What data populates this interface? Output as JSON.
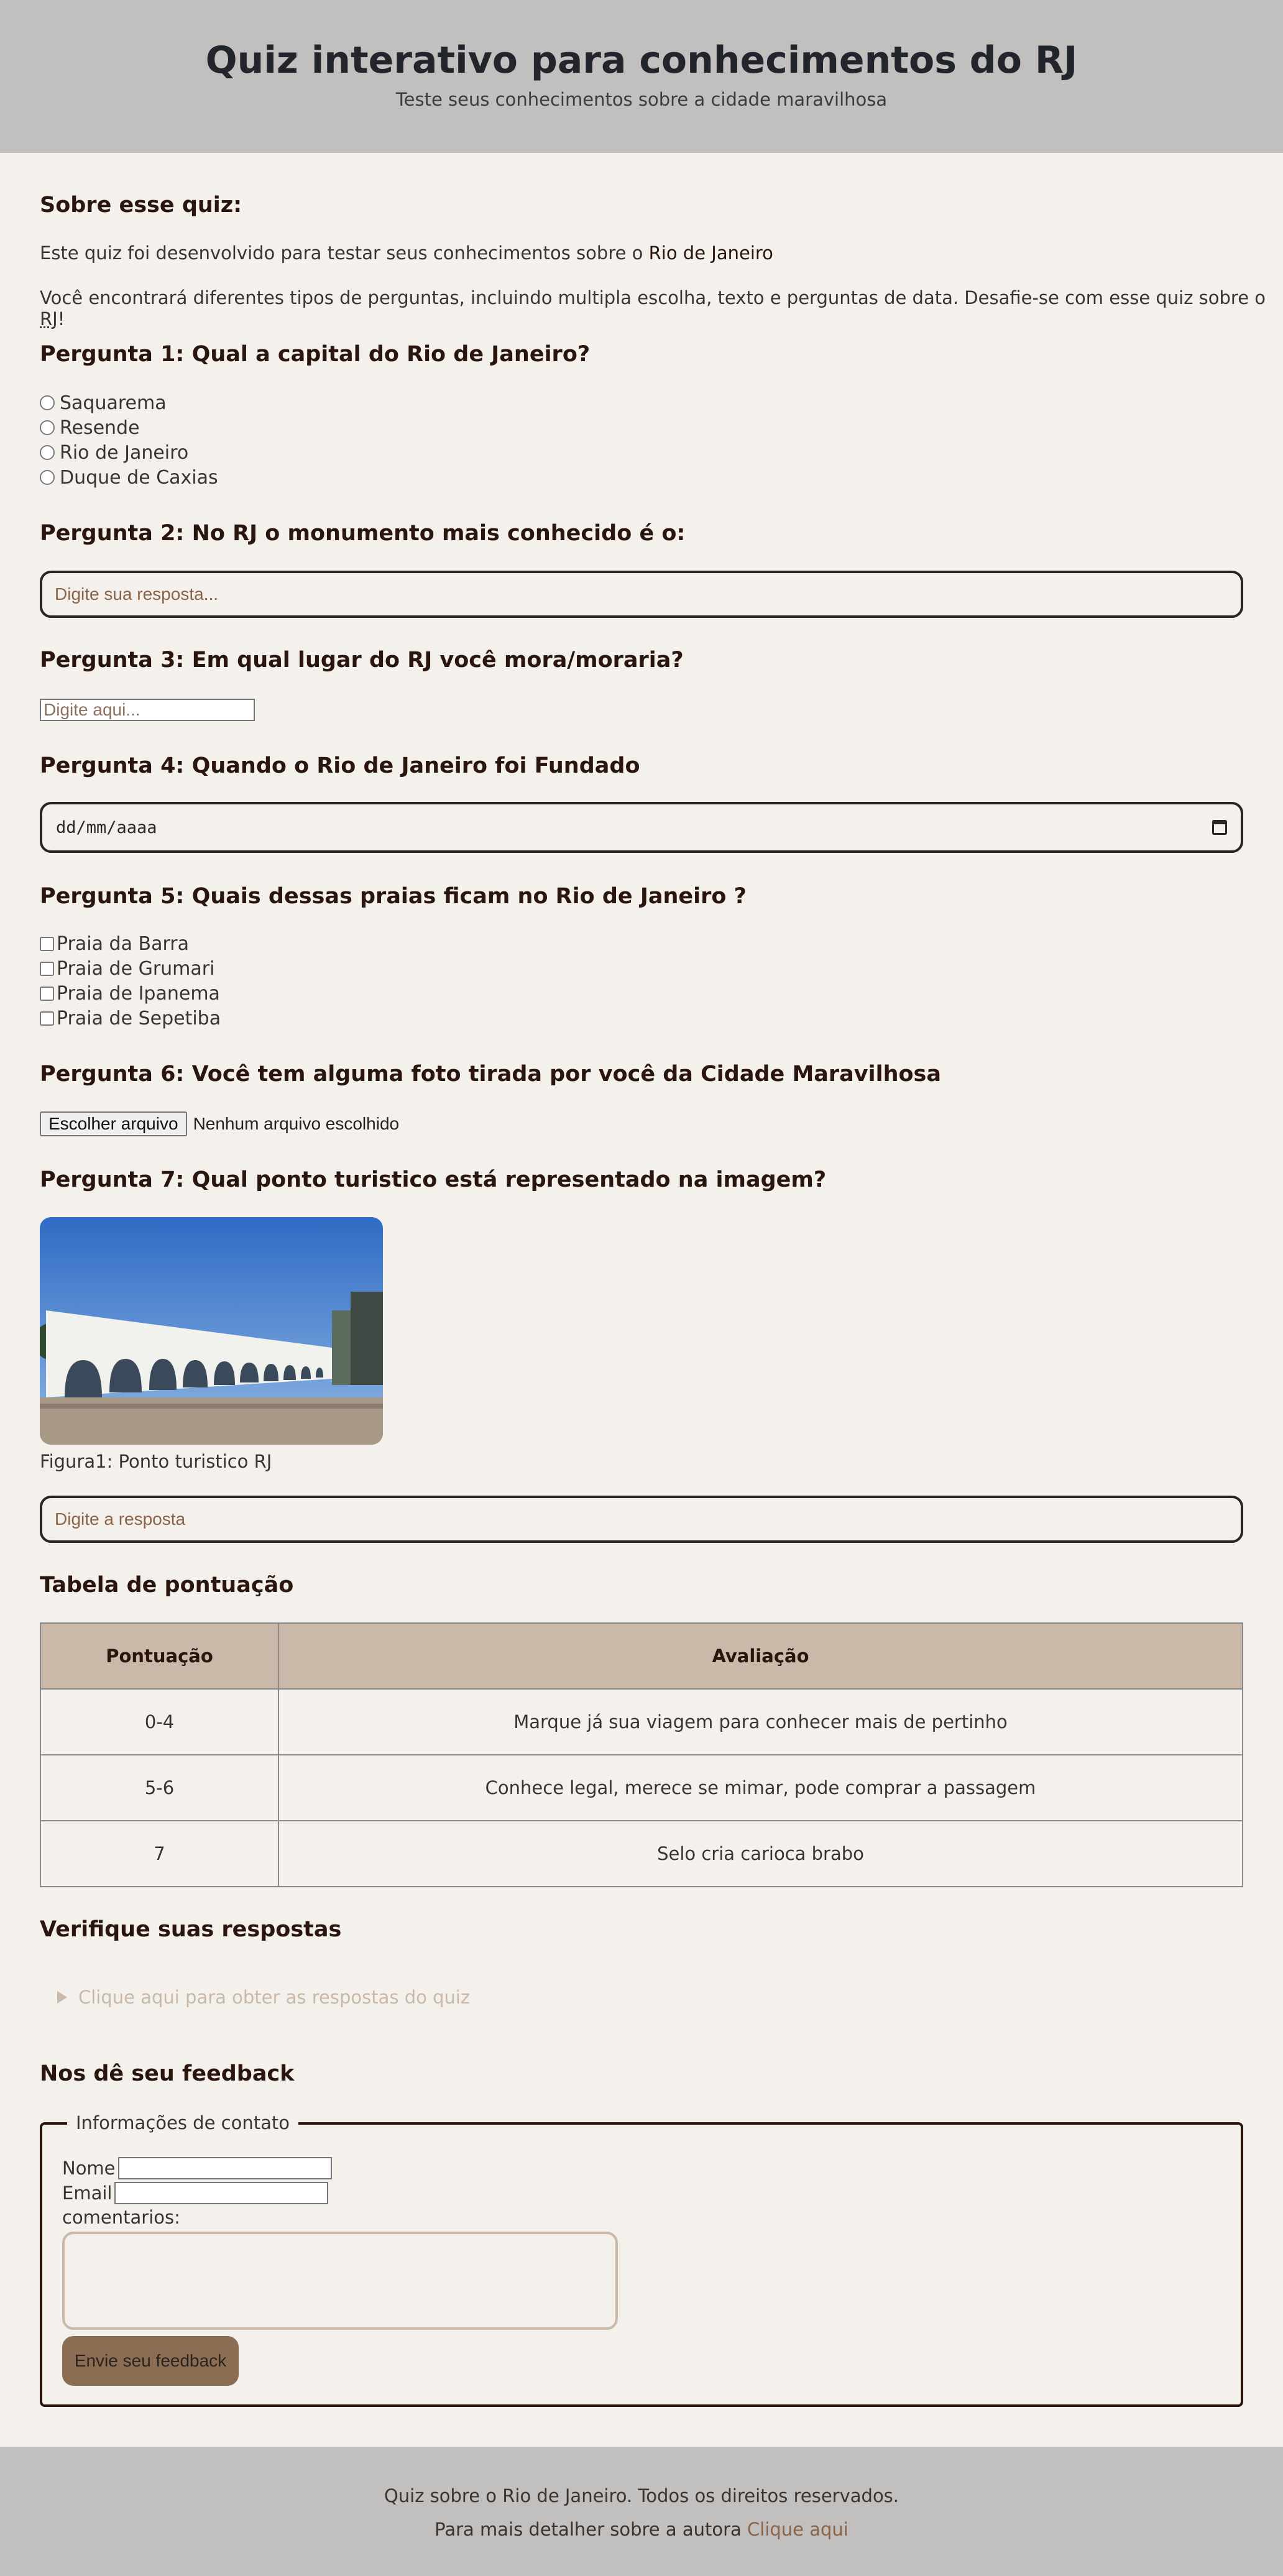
{
  "header": {
    "title": "Quiz interativo para conhecimentos do RJ",
    "subtitle": "Teste seus conhecimentos sobre a cidade maravilhosa"
  },
  "about": {
    "heading": "Sobre esse quiz:",
    "p1_text": "Este quiz foi desenvolvido para testar seus conhecimentos sobre o",
    "p1_strong": "Rio de Janeiro",
    "p2_text": "Você encontrará diferentes tipos de perguntas, incluindo multipla escolha, texto e perguntas de data. Desafie-se com esse quiz sobre o",
    "p2_abbr": "RJ",
    "p2_end": "!"
  },
  "q1": {
    "title": "Pergunta 1: Qual a capital do Rio de Janeiro?",
    "options": [
      "Saquarema",
      "Resende",
      "Rio de Janeiro",
      "Duque de Caxias"
    ]
  },
  "q2": {
    "title": "Pergunta 2: No RJ o monumento mais conhecido é o:",
    "placeholder": "Digite sua resposta..."
  },
  "q3": {
    "title": "Pergunta 3: Em qual lugar do RJ você mora/moraria?",
    "placeholder": "Digite aqui..."
  },
  "q4": {
    "title": "Pergunta 4: Quando o Rio de Janeiro foi Fundado",
    "date_placeholder": "dd/mm/aaaa"
  },
  "q5": {
    "title": "Pergunta 5: Quais dessas praias ficam no Rio de Janeiro ?",
    "options": [
      "Praia da Barra",
      "Praia de Grumari",
      "Praia de Ipanema",
      "Praia de Sepetiba"
    ]
  },
  "q6": {
    "title": "Pergunta 6: Você tem alguma foto tirada por você da Cidade Maravilhosa",
    "button": "Escolher arquivo",
    "no_file": "Nenhum arquivo escolhido"
  },
  "q7": {
    "title": "Pergunta 7: Qual ponto turistico está representado na imagem?",
    "caption": "Figura1: Ponto turistico RJ",
    "placeholder": "Digite a resposta"
  },
  "score": {
    "heading": "Tabela de pontuação",
    "columns": [
      "Pontuação",
      "Avaliação"
    ],
    "rows": [
      [
        "0-4",
        "Marque já sua viagem para conhecer mais de pertinho"
      ],
      [
        "5-6",
        "Conhece legal, merece se mimar, pode comprar a passagem"
      ],
      [
        "7",
        "Selo cria carioca brabo"
      ]
    ]
  },
  "verify": {
    "heading": "Verifique suas respostas",
    "summary": "Clique aqui para obter as respostas do quiz"
  },
  "feedback": {
    "heading": "Nos dê seu feedback",
    "legend": "Informações de contato",
    "name_label": "Nome",
    "email_label": "Email",
    "comments_label": "comentarios:",
    "button": "Envie seu feedback"
  },
  "footer": {
    "line1": "Quiz sobre o Rio de Janeiro. Todos os direitos reservados.",
    "line2": "Para mais detalher sobre a autora",
    "link": "Clique aqui"
  },
  "colors": {
    "header_bg": "#c1c0be",
    "page_bg": "#f4f1ec",
    "accent_brown": "#8a6d52",
    "table_header": "#cab9a8",
    "link": "#8b6346"
  }
}
